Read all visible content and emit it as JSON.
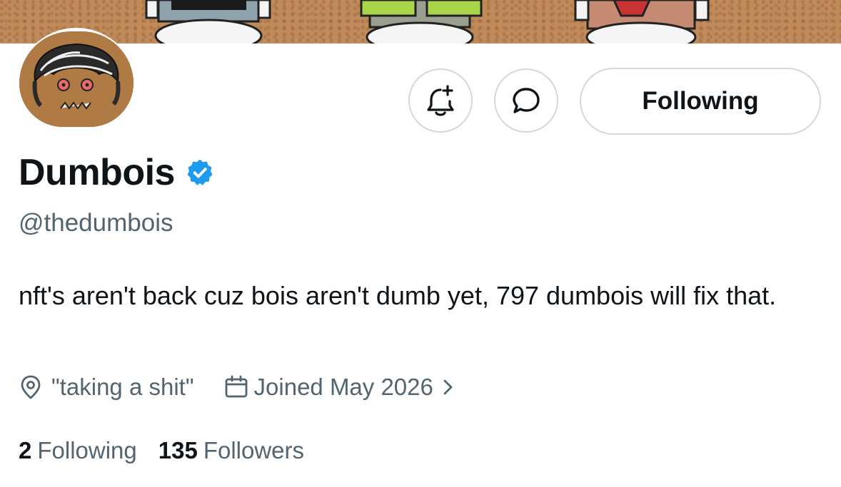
{
  "profile": {
    "name": "Dumbois",
    "handle": "@thedumbois",
    "bio": "nft's aren't back cuz bois aren't dumb yet, 797 dumbois will fix that.",
    "location": "\"taking a shit\"",
    "joined": "Joined May 2026",
    "verified": true
  },
  "actions": {
    "notify_icon": "bell-plus-icon",
    "message_icon": "message-bubble-icon",
    "follow_label": "Following"
  },
  "stats": {
    "following_count": "2",
    "following_label": "Following",
    "followers_count": "135",
    "followers_label": "Followers"
  },
  "colors": {
    "text_primary": "#0f1419",
    "text_secondary": "#536471",
    "verified_blue": "#1d9bf0",
    "border": "#cfd9de"
  }
}
